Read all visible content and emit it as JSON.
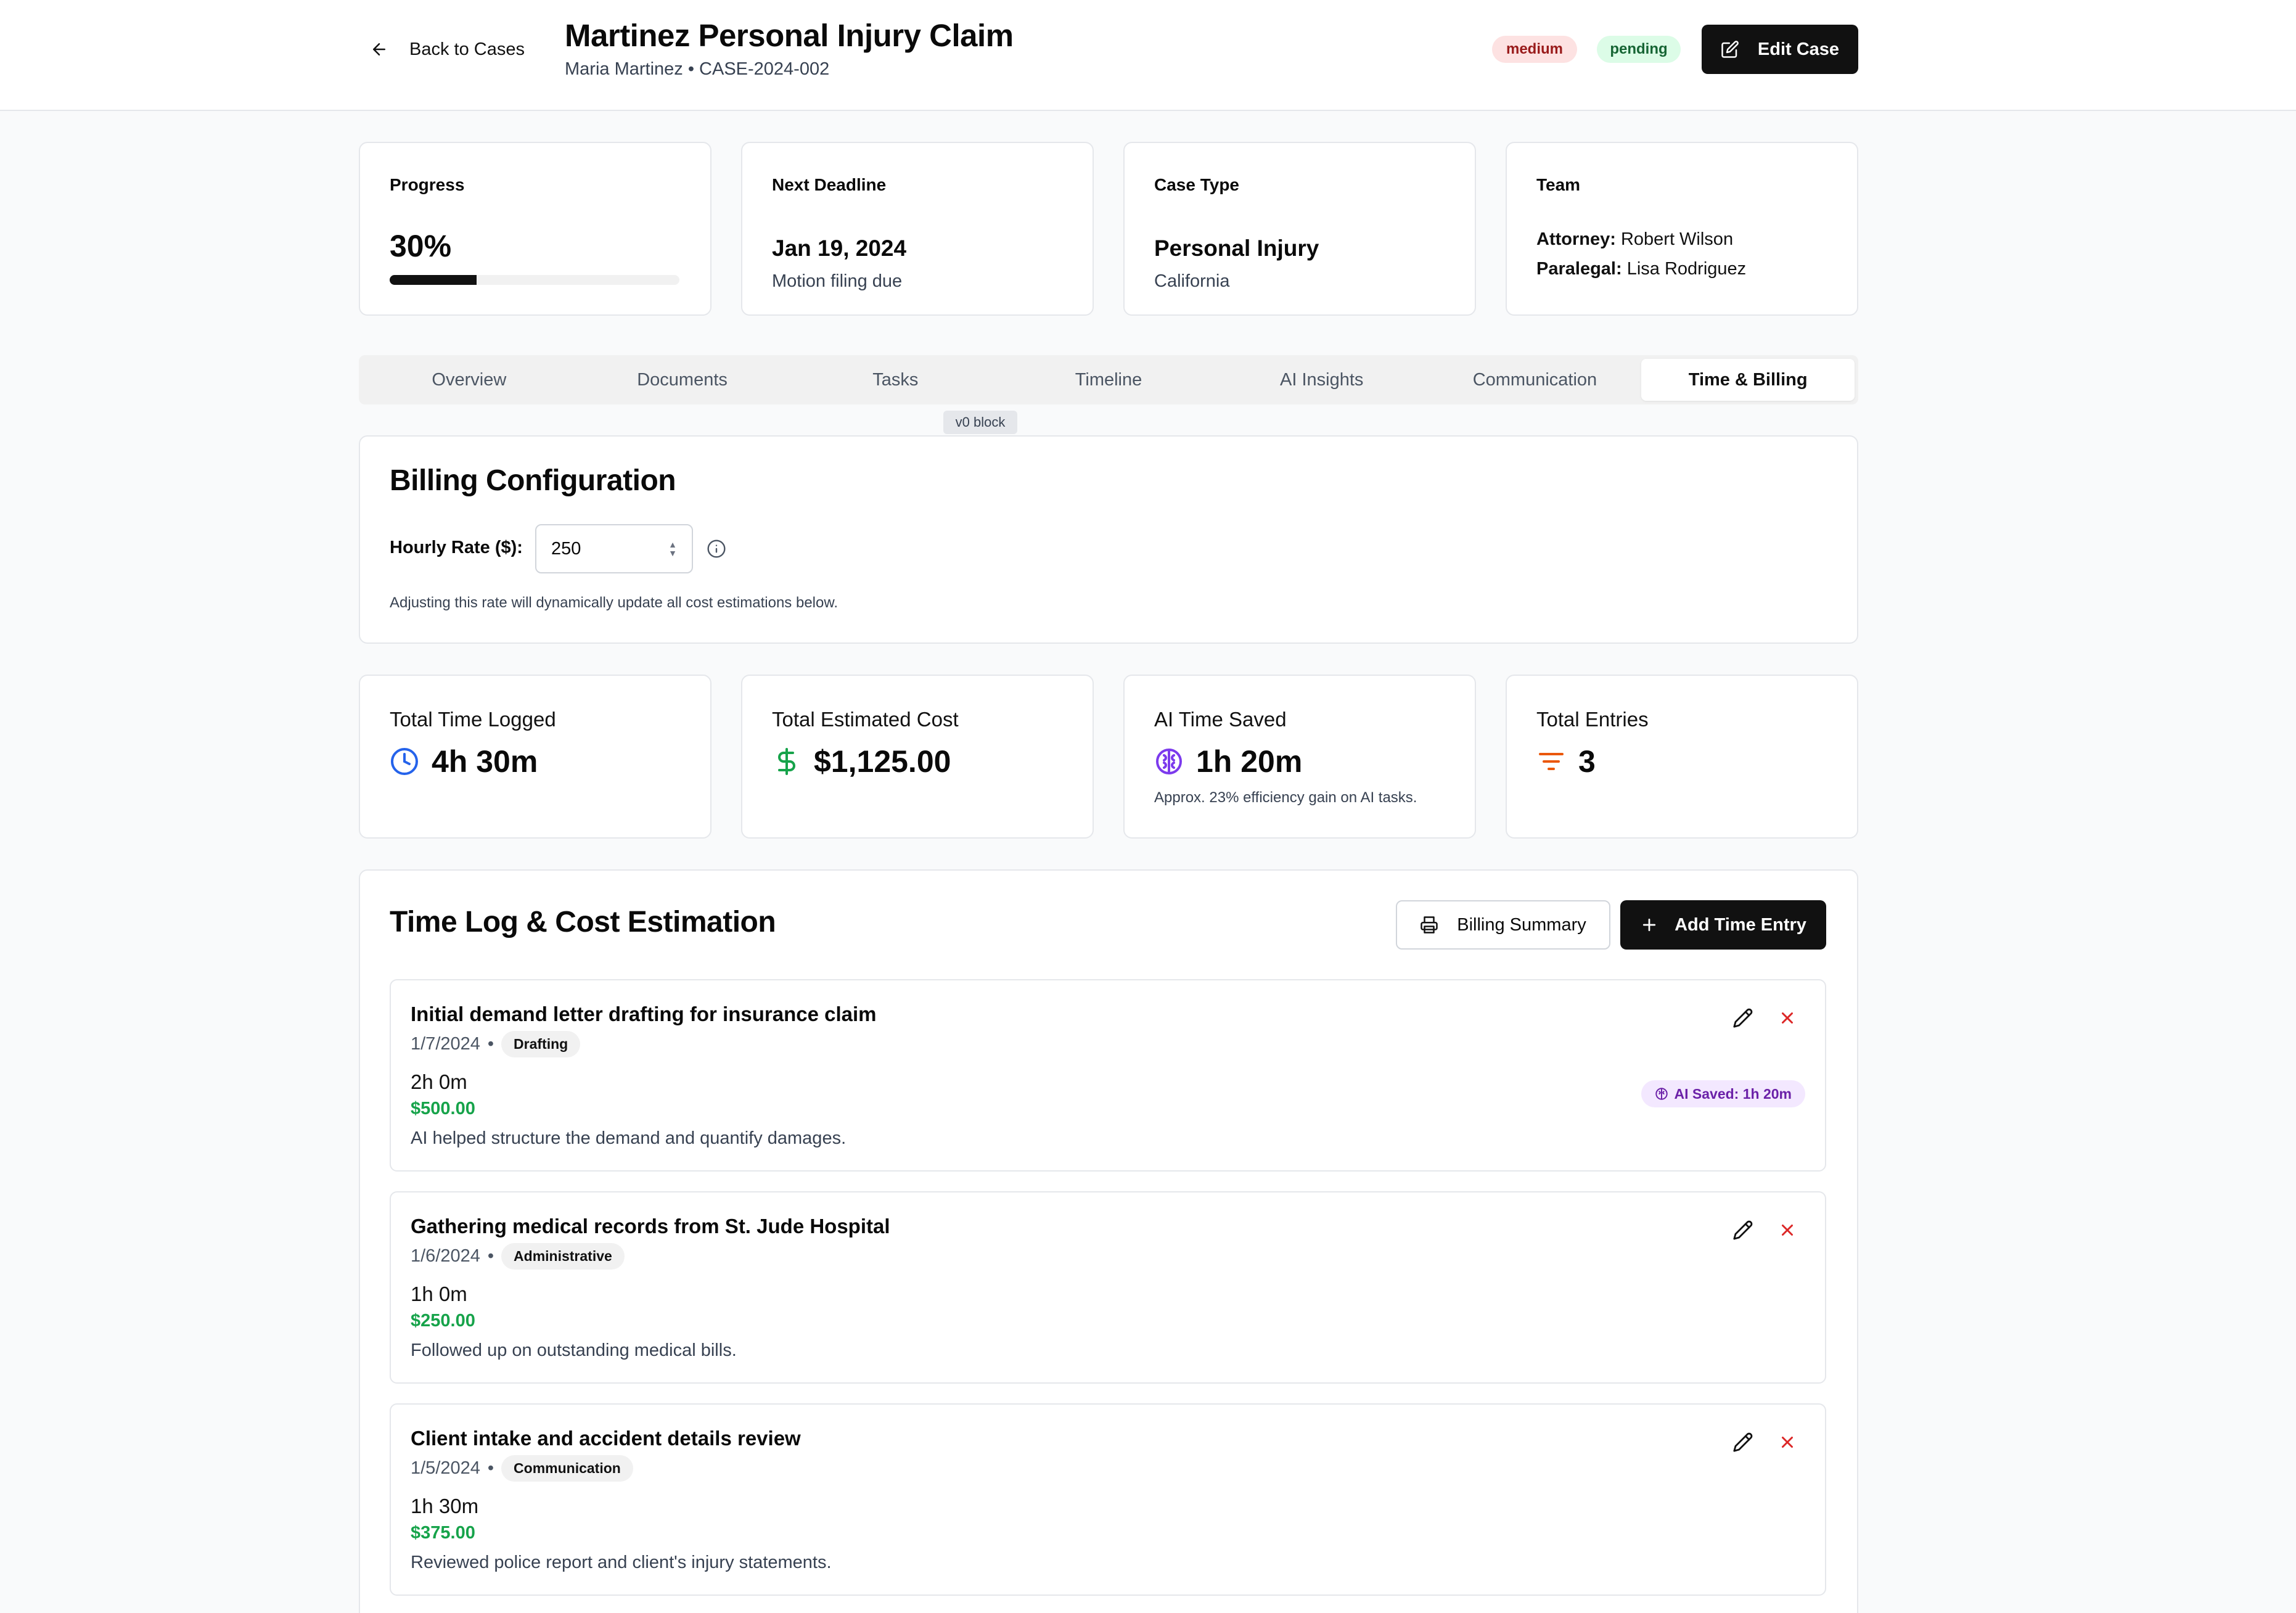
{
  "header": {
    "back_label": "Back to Cases",
    "title": "Martinez Personal Injury Claim",
    "subtitle": "Maria Martinez • CASE-2024-002",
    "priority_badge": "medium",
    "status_badge": "pending",
    "edit_label": "Edit Case"
  },
  "summary": {
    "progress": {
      "label": "Progress",
      "value": "30%",
      "fraction": 0.3
    },
    "deadline": {
      "label": "Next Deadline",
      "date": "Jan 19, 2024",
      "note": "Motion filing due"
    },
    "case_type": {
      "label": "Case Type",
      "type": "Personal Injury",
      "jurisdiction": "California"
    },
    "team": {
      "label": "Team",
      "attorney_label": "Attorney:",
      "attorney": "Robert Wilson",
      "paralegal_label": "Paralegal:",
      "paralegal": "Lisa Rodriguez"
    }
  },
  "tabs": [
    {
      "label": "Overview"
    },
    {
      "label": "Documents"
    },
    {
      "label": "Tasks"
    },
    {
      "label": "Timeline"
    },
    {
      "label": "AI Insights"
    },
    {
      "label": "Communication"
    },
    {
      "label": "Time & Billing",
      "active": true
    }
  ],
  "v0_block_label": "v0 block",
  "billing": {
    "title": "Billing Configuration",
    "rate_label": "Hourly Rate ($):",
    "rate_value": "250",
    "note": "Adjusting this rate will dynamically update all cost estimations below."
  },
  "metrics": {
    "time_logged": {
      "label": "Total Time Logged",
      "value": "4h 30m",
      "icon": "clock-icon",
      "color": "#2563eb"
    },
    "estimated_cost": {
      "label": "Total Estimated Cost",
      "value": "$1,125.00",
      "icon": "dollar-icon",
      "color": "#16a34a"
    },
    "ai_saved": {
      "label": "AI Time Saved",
      "value": "1h 20m",
      "note": "Approx. 23% efficiency gain on AI tasks.",
      "icon": "brain-icon",
      "color": "#7c3aed"
    },
    "entries": {
      "label": "Total Entries",
      "value": "3",
      "icon": "filter-icon",
      "color": "#ea580c"
    }
  },
  "time_log": {
    "title": "Time Log & Cost Estimation",
    "billing_summary_label": "Billing Summary",
    "add_entry_label": "Add Time Entry",
    "entries": [
      {
        "title": "Initial demand letter drafting for insurance claim",
        "date": "1/7/2024",
        "category": "Drafting",
        "duration": "2h 0m",
        "cost": "$500.00",
        "description": "AI helped structure the demand and quantify damages.",
        "ai_saved": "AI Saved: 1h 20m"
      },
      {
        "title": "Gathering medical records from St. Jude Hospital",
        "date": "1/6/2024",
        "category": "Administrative",
        "duration": "1h 0m",
        "cost": "$250.00",
        "description": "Followed up on outstanding medical bills."
      },
      {
        "title": "Client intake and accident details review",
        "date": "1/5/2024",
        "category": "Communication",
        "duration": "1h 30m",
        "cost": "$375.00",
        "description": "Reviewed police report and client's injury statements."
      }
    ]
  }
}
